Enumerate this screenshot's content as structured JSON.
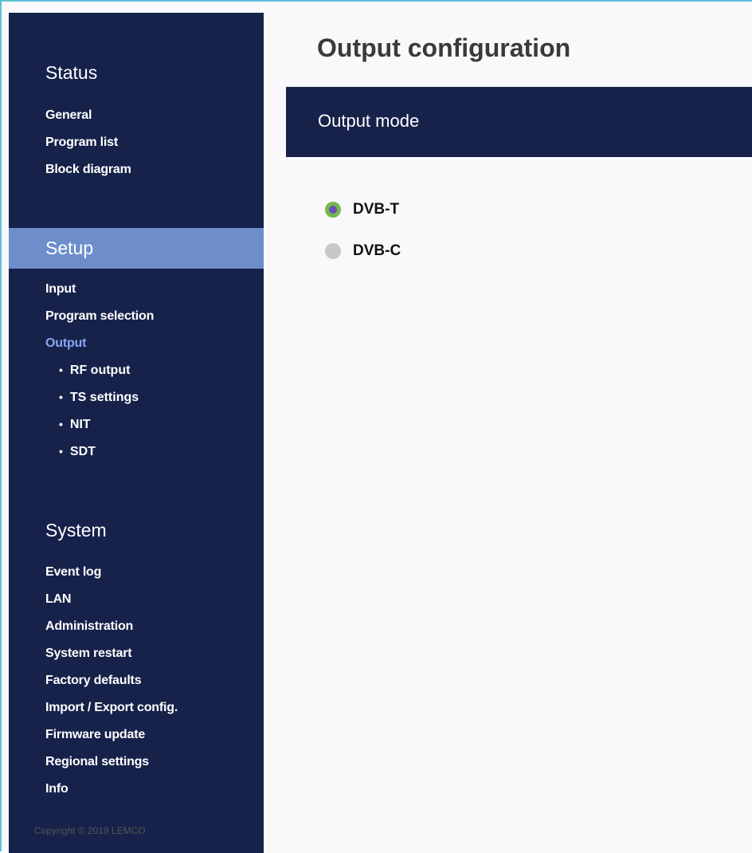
{
  "sidebar": {
    "status": {
      "title": "Status",
      "items": [
        {
          "label": "General"
        },
        {
          "label": "Program list"
        },
        {
          "label": "Block diagram"
        }
      ]
    },
    "setup": {
      "title": "Setup",
      "items": [
        {
          "label": "Input"
        },
        {
          "label": "Program selection"
        },
        {
          "label": "Output",
          "current": true
        }
      ],
      "subitems": [
        {
          "label": "RF output"
        },
        {
          "label": "TS settings"
        },
        {
          "label": "NIT"
        },
        {
          "label": "SDT"
        }
      ]
    },
    "system": {
      "title": "System",
      "items": [
        {
          "label": "Event log"
        },
        {
          "label": "LAN"
        },
        {
          "label": "Administration"
        },
        {
          "label": "System restart"
        },
        {
          "label": "Factory defaults"
        },
        {
          "label": "Import / Export config."
        },
        {
          "label": "Firmware update"
        },
        {
          "label": "Regional settings"
        },
        {
          "label": "Info"
        }
      ]
    }
  },
  "main": {
    "title": "Output configuration",
    "section_label": "Output mode",
    "options": [
      {
        "label": "DVB-T",
        "selected": true
      },
      {
        "label": "DVB-C",
        "selected": false
      }
    ],
    "copyright": "Copyright © 2019 LEMCO"
  },
  "colors": {
    "sidebar_bg": "#16224a",
    "active_section_bg": "#6d8ecb",
    "current_item": "#8ba5f0",
    "radio_selected_ring": "#72b94a",
    "radio_selected_dot": "#6a4fb8",
    "radio_unselected": "#c8c8c8"
  }
}
